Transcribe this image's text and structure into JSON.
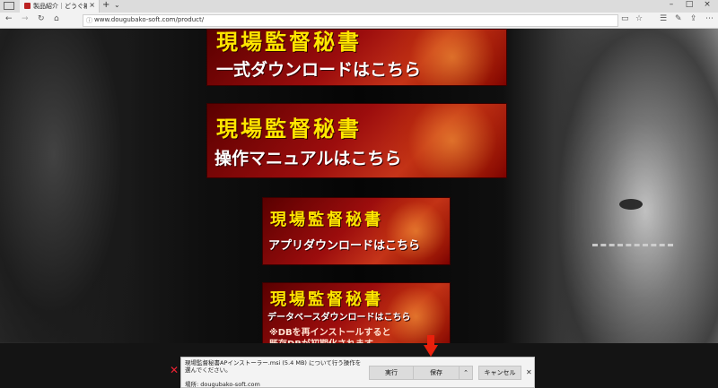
{
  "browser": {
    "tab_title": "製品紹介｜どうぐ箱ソフト",
    "url": "www.dougubako-soft.com/product/"
  },
  "banners": [
    {
      "line1": "現場監督秘書",
      "line2": "一式ダウンロードはこちら"
    },
    {
      "line1": "現場監督秘書",
      "line2": "操作マニュアルはこちら"
    },
    {
      "line1": "現場監督秘書",
      "line2": "アプリダウンロードはこちら"
    },
    {
      "line1": "現場監督秘書",
      "line2": "データベースダウンロードはこちら",
      "note1": "※DBを再インストールすると",
      "note2": "既存DBが初期化されます"
    }
  ],
  "download": {
    "message": "現場監督秘書APインストーラー.msi (5.4 MB) について行う操作を選んでください。",
    "location": "場所: dougubako-soft.com",
    "run_label": "実行",
    "save_label": "保存",
    "cancel_label": "キャンセル"
  },
  "colors": {
    "banner_title": "#ffe600",
    "banner_red": "#9c0d0d",
    "arrow_red": "#e8200c"
  }
}
